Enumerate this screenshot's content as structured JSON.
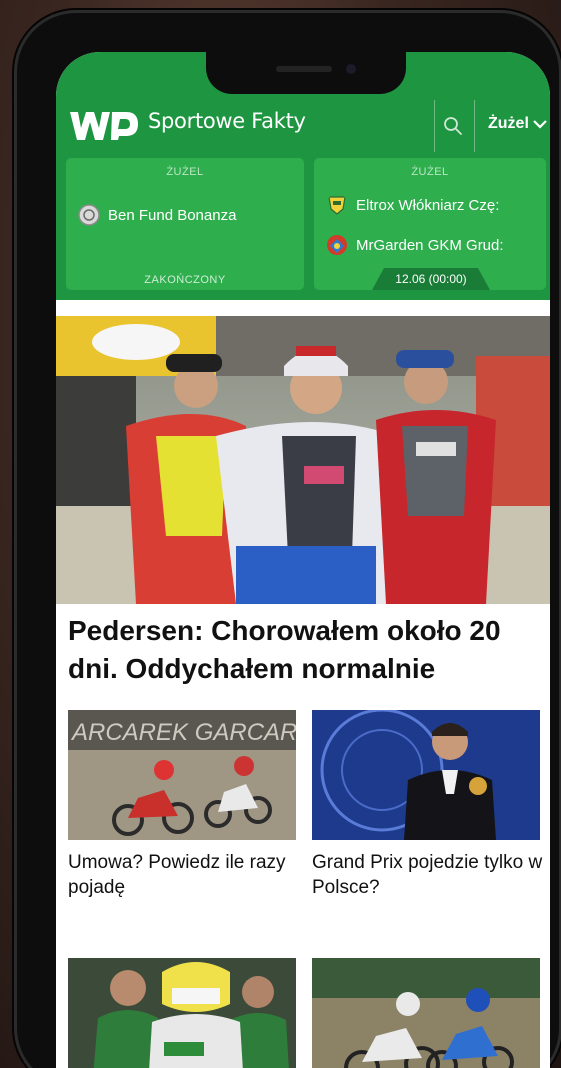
{
  "header": {
    "brand": "Sportowe Fakty",
    "sport_selector": "Żużel"
  },
  "scores": [
    {
      "category": "ŻUŻEL",
      "teams": [
        "Ben Fund Bonanza"
      ],
      "status": "ZAKOŃCZONY"
    },
    {
      "category": "ŻUŻEL",
      "teams": [
        "Eltrox Włókniarz Czę:",
        "MrGarden GKM Grud:"
      ],
      "time": "12.06 (00:00)"
    }
  ],
  "main_article": {
    "headline": "Pedersen: Chorowałem około 20 dni. Oddychałem normalnie"
  },
  "articles": [
    {
      "caption": "Umowa? Powiedz ile razy pojadę",
      "image_text": "ARCAREK GARCARE"
    },
    {
      "caption": "Grand Prix pojedzie tylko w Polsce?"
    },
    {
      "caption": ""
    },
    {
      "caption": ""
    }
  ],
  "colors": {
    "brand_green": "#1e9540",
    "card_green": "#2fae4e",
    "time_tab": "#1a7d37"
  }
}
